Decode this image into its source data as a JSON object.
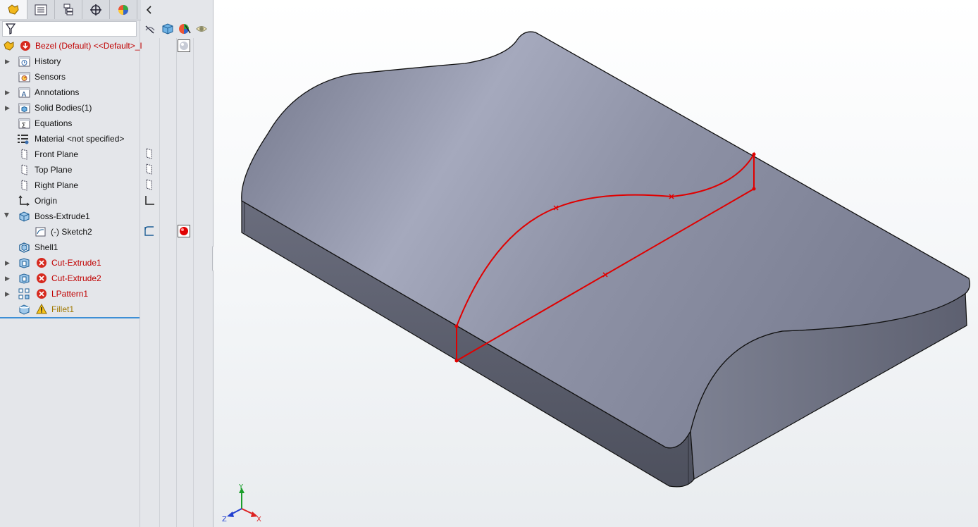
{
  "panel": {
    "tabs": [
      "featuremanager-tab",
      "propertymanager-tab",
      "configurationmanager-tab",
      "dimxpertmanager-tab",
      "displaymanager-tab"
    ],
    "filter_placeholder": ""
  },
  "tree": {
    "root": "Bezel (Default) <<Default>_I",
    "items": [
      {
        "label": "History"
      },
      {
        "label": "Sensors"
      },
      {
        "label": "Annotations"
      },
      {
        "label": "Solid Bodies(1)"
      },
      {
        "label": "Equations"
      },
      {
        "label": "Material <not specified>"
      },
      {
        "label": "Front Plane"
      },
      {
        "label": "Top Plane"
      },
      {
        "label": "Right Plane"
      },
      {
        "label": "Origin"
      },
      {
        "label": "Boss-Extrude1"
      },
      {
        "label": "(-) Sketch2"
      },
      {
        "label": "Shell1"
      },
      {
        "label": "Cut-Extrude1"
      },
      {
        "label": "Cut-Extrude2"
      },
      {
        "label": "LPattern1"
      },
      {
        "label": "Fillet1"
      }
    ]
  },
  "triad": {
    "x": "X",
    "y": "Y",
    "z": "Z"
  },
  "colors": {
    "error": "#c00000",
    "warning": "#a07800",
    "sketch": "#e00000",
    "body": "#7c8094"
  }
}
